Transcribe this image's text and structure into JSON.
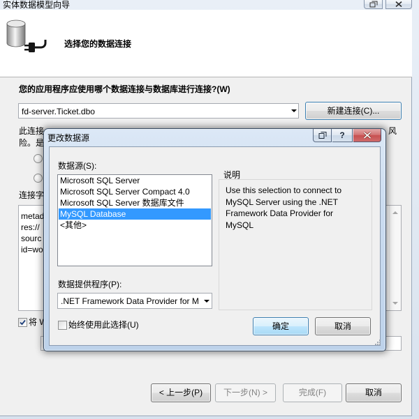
{
  "wizard": {
    "title": "实体数据模型向导",
    "header_title": "选择您的数据连接",
    "connection_question": "您的应用程序应使用哪个数据连接与数据库进行连接?(W)",
    "connection_combo": {
      "value": "fd-server.Ticket.dbo"
    },
    "new_connection_button": "新建连接(C)...",
    "sensitive_data_text": {
      "line1_left": "此连接",
      "line1_right": "风",
      "line2_left": "险。是"
    },
    "connection_string": {
      "label": "连接字",
      "lines": [
        "metad",
        "res://",
        "sourc",
        "id=wo"
      ]
    },
    "save_settings": {
      "checked": true,
      "label": "将 W"
    },
    "footer_buttons": {
      "back": "< 上一步(P)",
      "next": "下一步(N) >",
      "finish": "完成(F)",
      "cancel": "取消"
    }
  },
  "dialog": {
    "title": "更改数据源",
    "help_button": "?",
    "data_source_label": "数据源(S):",
    "data_source_list": {
      "items": [
        "Microsoft SQL Server",
        "Microsoft SQL Server Compact 4.0",
        "Microsoft SQL Server 数据库文件",
        "MySQL Database",
        "<其他>"
      ],
      "selected_index": 3
    },
    "description_label": "说明",
    "description_text": "Use this selection to connect to MySQL Server using the .NET Framework Data Provider for MySQL",
    "provider_label": "数据提供程序(P):",
    "provider_combo": {
      "value": ".NET Framework Data Provider for M"
    },
    "always_use": {
      "checked": false,
      "label": "始终使用此选择(U)"
    },
    "ok_button": "确定",
    "cancel_button": "取消"
  },
  "icons": {
    "header": "database-connection-icon",
    "caption_extra": "window-icon",
    "caption_close": "close-icon",
    "dropdown": "chevron-down-icon",
    "checkbox": "checkmark-icon",
    "resize": "resize-grip-icon"
  },
  "colors": {
    "selection": "#3399ff",
    "close_button": "#c75050",
    "focus_border": "#3c7fb1"
  }
}
